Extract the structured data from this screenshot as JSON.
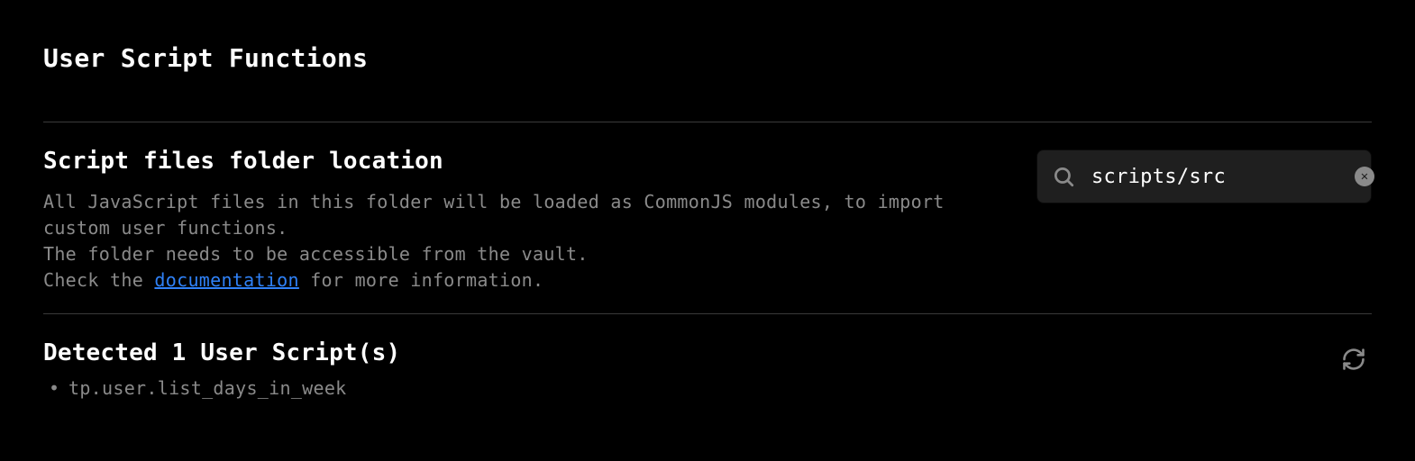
{
  "section_title": "User Script Functions",
  "setting": {
    "heading": "Script files folder location",
    "desc_line1": "All JavaScript files in this folder will be loaded as CommonJS modules, to import custom user functions.",
    "desc_line2": "The folder needs to be accessible from the vault.",
    "desc_line3_prefix": "Check the ",
    "desc_link_text": "documentation",
    "desc_line3_suffix": " for more information.",
    "search_value": "scripts/src"
  },
  "detected": {
    "heading": "Detected 1 User Script(s)",
    "scripts": [
      "tp.user.list_days_in_week"
    ]
  },
  "colors": {
    "link": "#2f81f7",
    "muted": "#8a8a8a",
    "input_bg": "#1f1f1f"
  }
}
